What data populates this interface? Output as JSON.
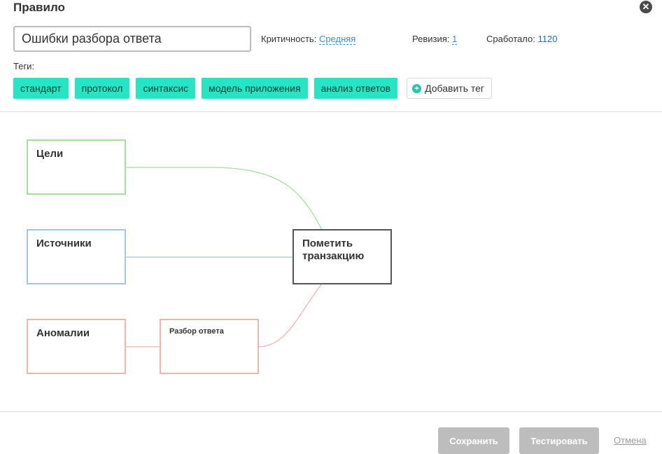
{
  "header": {
    "title": "Правило",
    "close_glyph": "✕"
  },
  "rule": {
    "name": "Ошибки разбора ответа",
    "criticality_label": "Критичность:",
    "criticality_value": "Средняя",
    "revision_label": "Ревизия:",
    "revision_value": "1",
    "triggered_label": "Сработало:",
    "triggered_value": "1120"
  },
  "tags": {
    "label": "Теги:",
    "items": [
      "стандарт",
      "протокол",
      "синтаксис",
      "модель приложения",
      "анализ ответов"
    ],
    "add_label": "Добавить тег"
  },
  "graph": {
    "nodes": {
      "goals": "Цели",
      "sources": "Источники",
      "anomalies": "Аномалии",
      "parse": "Разбор ответа",
      "mark": "Пометить транзакцию"
    },
    "colors": {
      "goals": "#a9dca0",
      "sources": "#9fc9dc",
      "anomalies": "#eab6b0",
      "mark": "#555555"
    }
  },
  "footer": {
    "save_label": "Сохранить",
    "test_label": "Тестировать",
    "cancel_label": "Отмена"
  }
}
